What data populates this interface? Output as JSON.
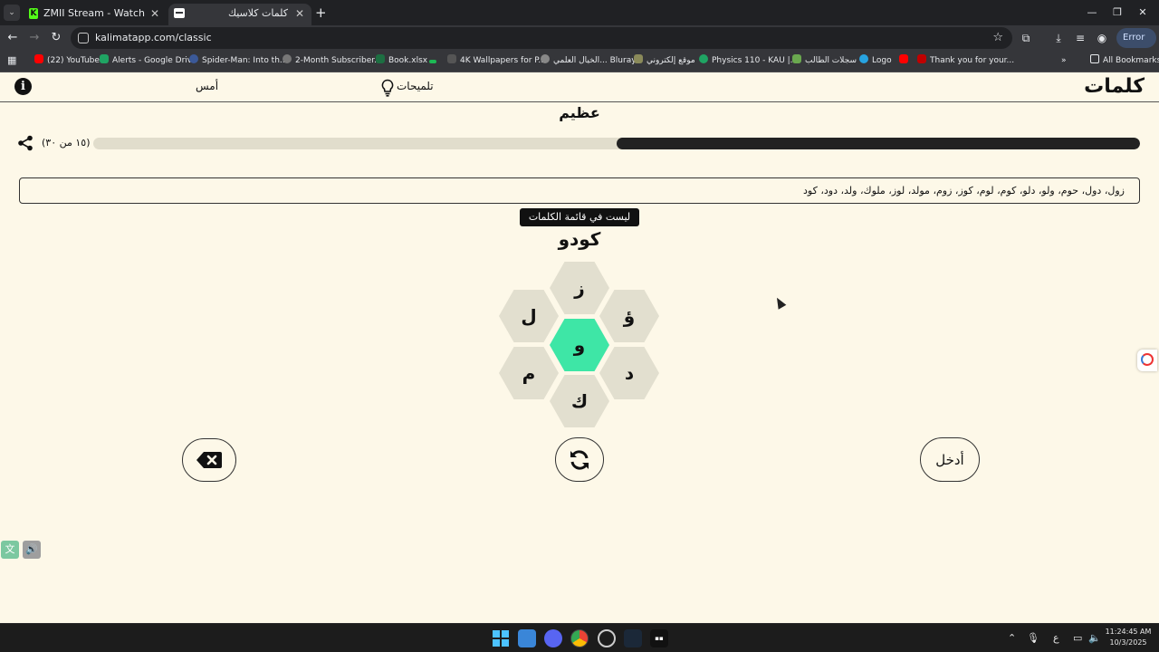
{
  "browser": {
    "tabs": [
      {
        "title": "ZMII Stream - Watch Live on Ki",
        "active": false
      },
      {
        "title": "كلمات كلاسيك",
        "active": true
      }
    ],
    "url": "kalimatapp.com/classic",
    "profile_label": "Error",
    "bookmarks": [
      {
        "label": "(22) YouTube",
        "icon_color": "#ff0000"
      },
      {
        "label": "Alerts - Google Drive",
        "icon_color": "#1fa463"
      },
      {
        "label": "Spider-Man: Into th...",
        "icon_color": "#3b5998"
      },
      {
        "label": "2-Month Subscriber...",
        "icon_color": "#777777"
      },
      {
        "label": "Book.xlsx",
        "icon_color": "#1d6f42"
      },
      {
        "label": "4K Wallpapers for P...",
        "icon_color": "#1db954"
      },
      {
        "label": "الخيال العلمي... Bluray",
        "icon_color": "#888888"
      },
      {
        "label": "موقع إلكتروني",
        "icon_color": "#8a8a5a"
      },
      {
        "label": "Physics 110 - KAU |...",
        "icon_color": "#1fa463"
      },
      {
        "label": "سجلات الطالب",
        "icon_color": "#6aa84f"
      },
      {
        "label": "Logo",
        "icon_color": "#27a3e0"
      },
      {
        "label": "",
        "icon_color": "#ff0000"
      },
      {
        "label": "Thank you for your...",
        "icon_color": "#c00000"
      }
    ],
    "all_bookmarks_label": "All Bookmarks"
  },
  "app": {
    "logo": "كلمات",
    "hints_label": "تلميحات",
    "yesterday_label": "أمس",
    "rank": "عظيم",
    "score_text": "(١٥ من ٣٠)",
    "progress_fraction": 0.5,
    "found_words": "زول، دول، حوم، ولو، دلو، كوم، لوم، كوز، زوم، مولد، لوز، ملوك، ولد، دود، كود",
    "toast": "ليست في قائمة الكلمات",
    "current_word": "كودو",
    "letters": {
      "center": "و",
      "top": "ز",
      "top_left": "ل",
      "top_right": "ؤ",
      "bottom_left": "م",
      "bottom_right": "د",
      "bottom": "ك"
    },
    "center_color": "#3ee6a6",
    "enter_label": "أدخل"
  },
  "taskbar": {
    "language": "ع",
    "time": "11:24:45 AM",
    "date": "10/3/2025"
  }
}
